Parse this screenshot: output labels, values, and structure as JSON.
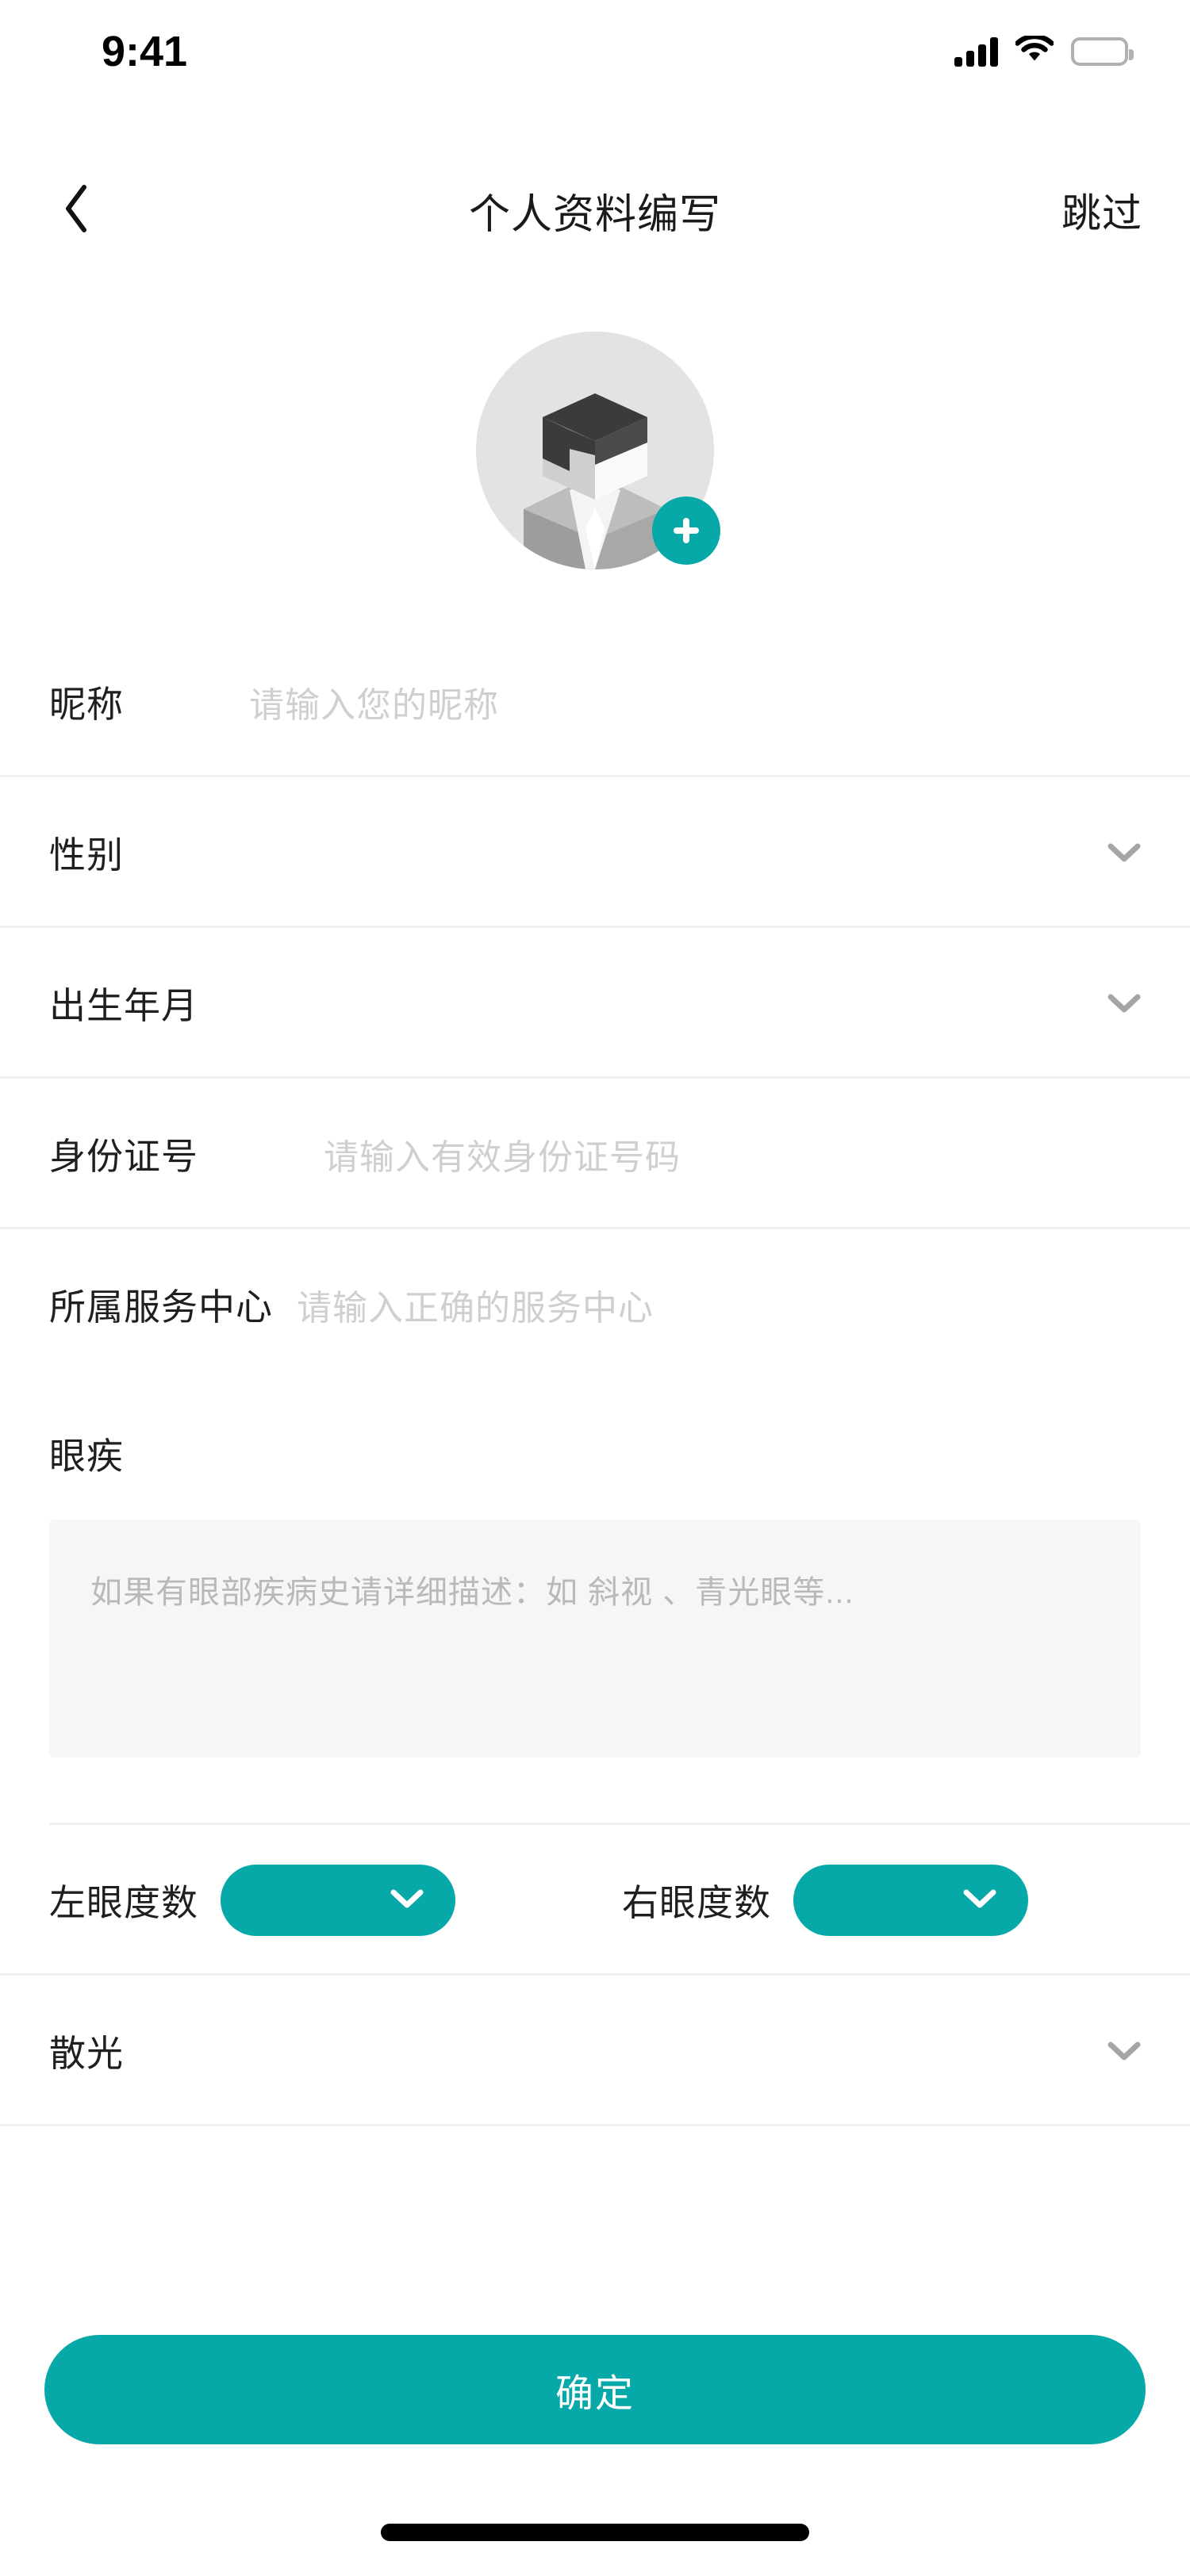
{
  "status_bar": {
    "time": "9:41",
    "cellular_icon": "signal-bars-icon",
    "wifi_icon": "wifi-icon",
    "battery_icon": "battery-full-icon"
  },
  "header": {
    "back_icon": "chevron-left-icon",
    "title": "个人资料编写",
    "skip_label": "跳过"
  },
  "avatar": {
    "placeholder_icon": "user-cube-avatar-icon",
    "add_badge_icon": "plus-icon",
    "badge_color": "#06a8a8"
  },
  "form": {
    "fields": [
      {
        "label": "昵称",
        "placeholder": "请输入您的昵称",
        "type": "text"
      },
      {
        "label": "性别",
        "placeholder": "",
        "type": "select"
      },
      {
        "label": "出生年月",
        "placeholder": "",
        "type": "select"
      },
      {
        "label": "身份证号",
        "placeholder": "请输入有效身份证号码",
        "type": "text"
      },
      {
        "label": "所属服务中心",
        "placeholder": "请输入正确的服务中心",
        "type": "text"
      }
    ],
    "eye_disease": {
      "label": "眼疾",
      "placeholder": "如果有眼部疾病史请详细描述：如 斜视 、青光眼等..."
    },
    "eye_degree": {
      "left_label": "左眼度数",
      "left_value": "",
      "right_label": "右眼度数",
      "right_value": ""
    },
    "astigmatism": {
      "label": "散光",
      "value": ""
    },
    "chevron_icon": "chevron-down-icon"
  },
  "submit": {
    "label": "确定",
    "color": "#06a8a8"
  },
  "colors": {
    "accent": "#06a8a8",
    "label_text": "#1f1f1f",
    "placeholder_text": "#cfcfcf",
    "divider": "#f1f1f1",
    "textarea_bg": "#f6f6f6"
  }
}
